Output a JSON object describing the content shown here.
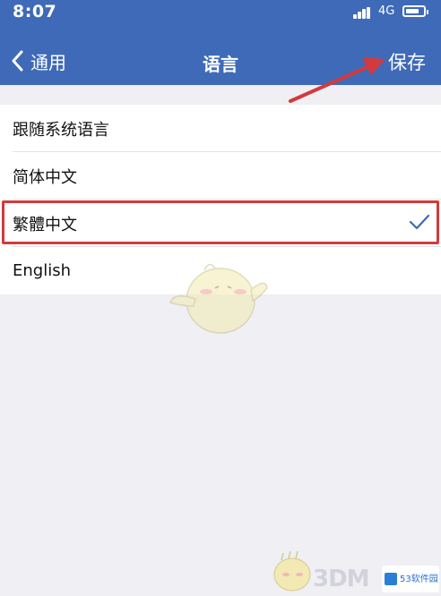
{
  "status_bar": {
    "time": "8:07",
    "network": "4G",
    "battery_level": 0.8
  },
  "nav": {
    "back_label": "通用",
    "title": "语言",
    "save_label": "保存"
  },
  "languages": [
    {
      "label": "跟随系统语言",
      "selected": false
    },
    {
      "label": "简体中文",
      "selected": false
    },
    {
      "label": "繁體中文",
      "selected": true
    },
    {
      "label": "English",
      "selected": false
    }
  ],
  "watermark": {
    "text": "3DM",
    "badge_text": "53软件园"
  },
  "colors": {
    "header": "#3f6ab8",
    "annotation": "#d23a3d",
    "check": "#3f6ab8"
  }
}
